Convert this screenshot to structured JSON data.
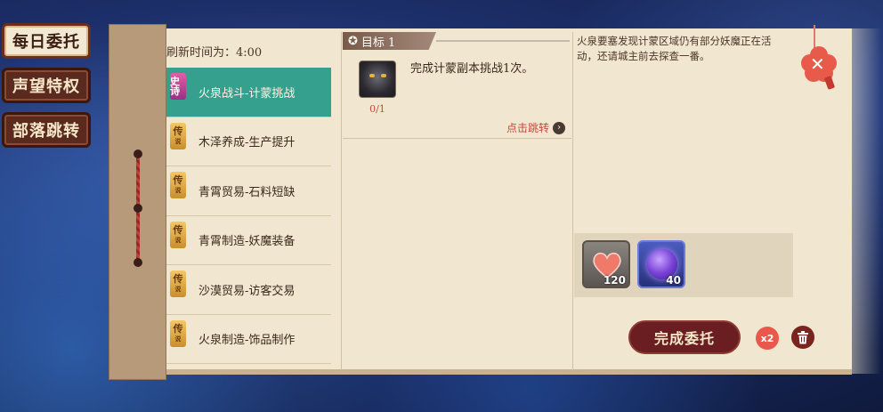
{
  "side_tabs": [
    {
      "label": "每日委托",
      "active": true
    },
    {
      "label": "声望特权",
      "active": false
    },
    {
      "label": "部落跳转",
      "active": false
    }
  ],
  "refresh_text": "刷新时间为：4:00",
  "tasks": [
    {
      "label": "火泉战斗-计蒙挑战",
      "badge": "史诗",
      "badge_sub": "",
      "active": true
    },
    {
      "label": "木泽养成-生产提升",
      "badge": "传",
      "badge_sub": "说",
      "active": false
    },
    {
      "label": "青霄贸易-石料短缺",
      "badge": "传",
      "badge_sub": "说",
      "active": false
    },
    {
      "label": "青霄制造-妖魔装备",
      "badge": "传",
      "badge_sub": "说",
      "active": false
    },
    {
      "label": "沙漠贸易-访客交易",
      "badge": "传",
      "badge_sub": "说",
      "active": false
    },
    {
      "label": "火泉制造-饰品制作",
      "badge": "传",
      "badge_sub": "说",
      "active": false
    }
  ],
  "goal": {
    "tag": "目标 1",
    "text": "完成计蒙副本挑战1次。",
    "progress": "0/1",
    "jump_label": "点击跳转"
  },
  "description": "火泉要塞发现计蒙区域仍有部分妖魔正在活动，还请城主前去探查一番。",
  "rewards": [
    {
      "icon": "heart-icon",
      "qty": "120"
    },
    {
      "icon": "orb-icon",
      "qty": "40"
    }
  ],
  "buttons": {
    "complete": "完成委托",
    "double": "x2"
  },
  "colors": {
    "active_task": "#35a08d",
    "primary_button": "#6a1e22",
    "accent_red": "#e9584a"
  }
}
